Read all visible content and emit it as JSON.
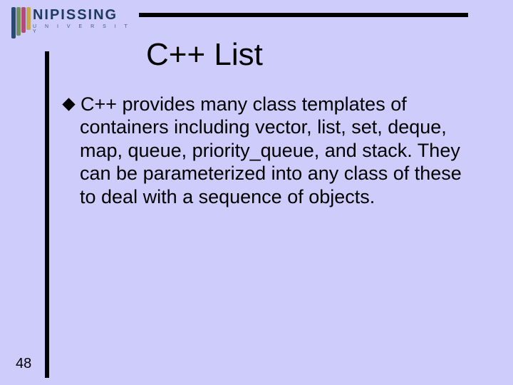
{
  "logo": {
    "title": "NIPISSING",
    "subtitle": "U N I V E R S I T Y"
  },
  "slide": {
    "title": "C++ List",
    "bullet_first": "C++ provides many class templates of",
    "bullet_rest": "containers including vector, list, set, deque, map, queue, priority_queue, and stack. They can be parameterized into any class of these to deal with a sequence of objects."
  },
  "page_number": "48"
}
